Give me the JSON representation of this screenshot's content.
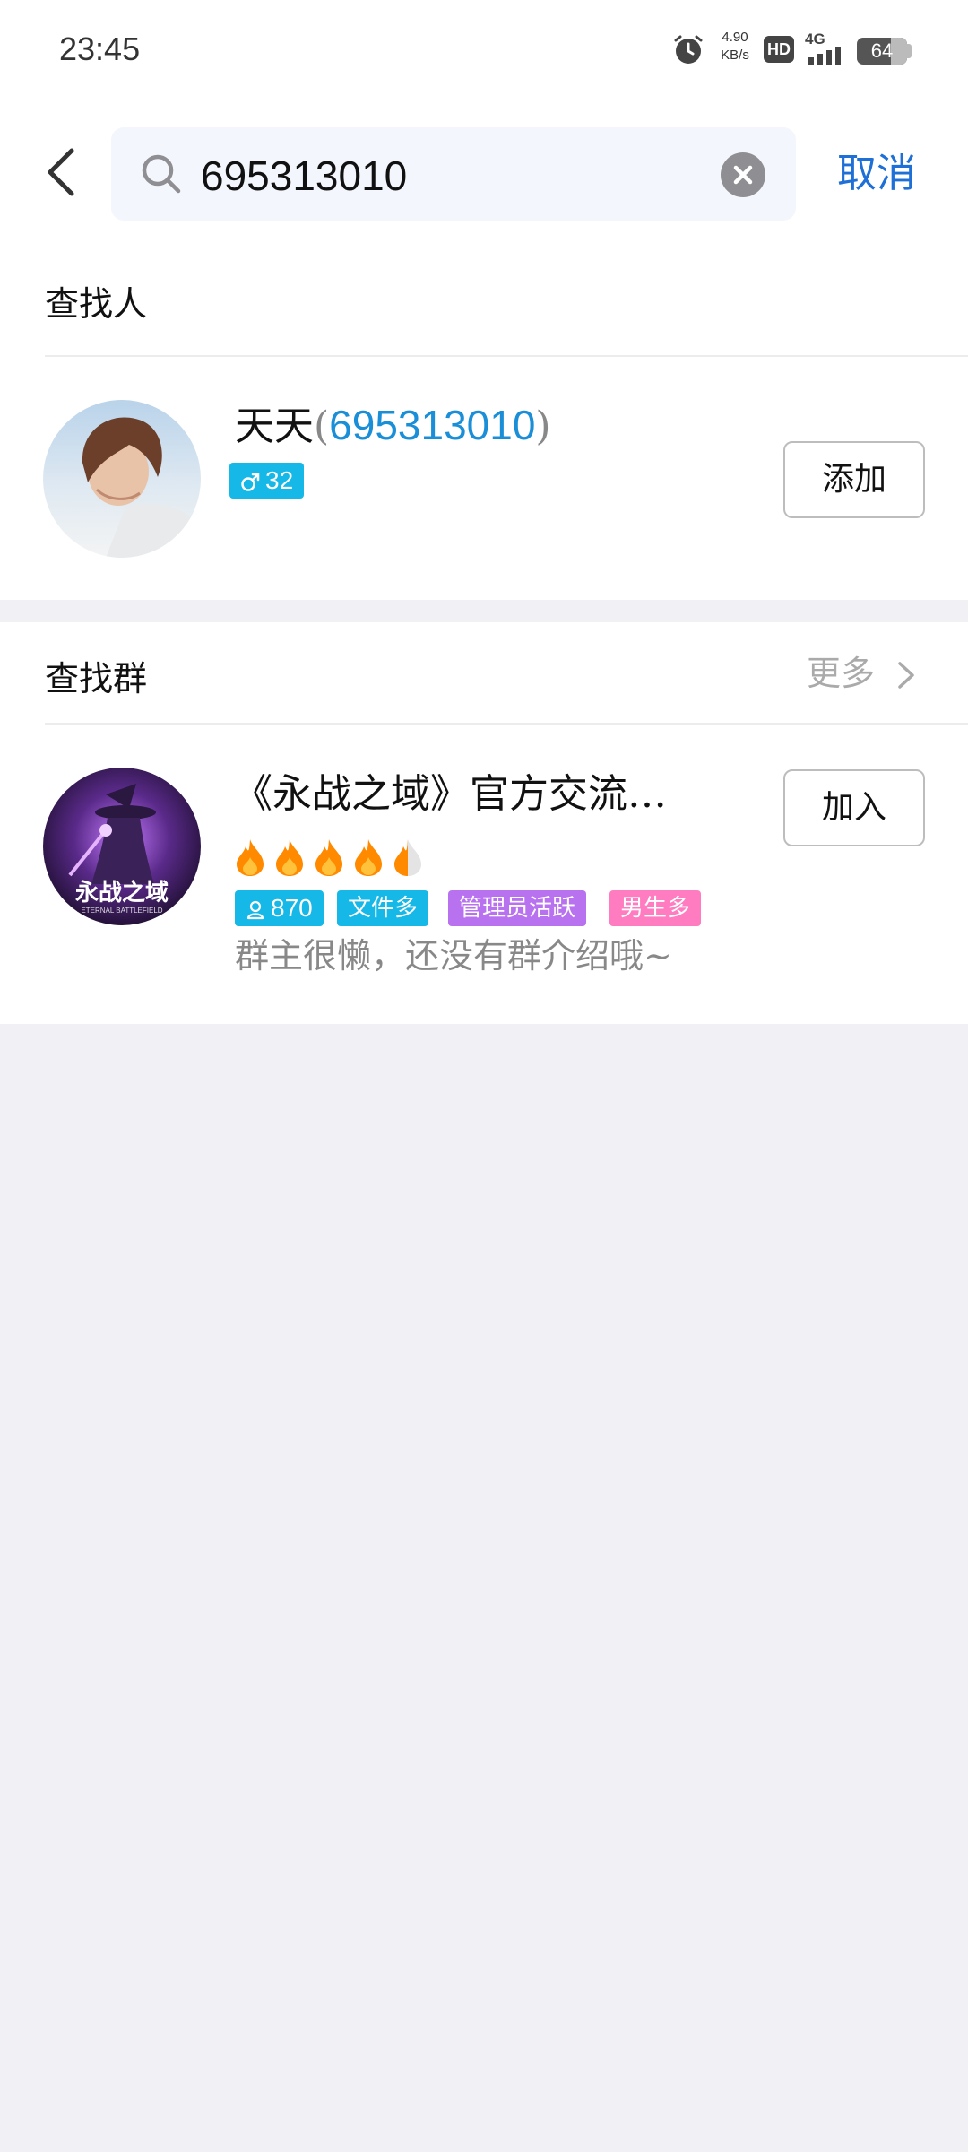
{
  "status_bar": {
    "time": "23:45",
    "net_speed_value": "4.90",
    "net_speed_unit": "KB/s",
    "hd_label": "HD",
    "network_label": "4G",
    "battery": "64"
  },
  "search": {
    "query": "695313010",
    "cancel_label": "取消"
  },
  "people_section": {
    "title": "查找人",
    "result": {
      "name": "天天",
      "open_paren": "(",
      "uid": "695313010",
      "close_paren": ")",
      "gender_age": "32",
      "add_label": "添加"
    }
  },
  "group_section": {
    "title": "查找群",
    "more_label": "更多",
    "result": {
      "name": "《永战之域》官方交流…",
      "avatar_text": "永战之域",
      "avatar_subtext": "ETERNAL BATTLEFIELD",
      "join_label": "加入",
      "heat_level": 4.5,
      "members": "870",
      "tags": [
        "文件多",
        "管理员活跃",
        "男生多"
      ],
      "description": "群主很懒，还没有群介绍哦~"
    }
  },
  "colors": {
    "accent_blue": "#1e6fd6",
    "uid_blue": "#1a8fd8",
    "tag_cyan": "#16b8e8",
    "tag_purple": "#b872f0",
    "tag_pink": "#ff7cc0",
    "background": "#f0f0f5"
  }
}
